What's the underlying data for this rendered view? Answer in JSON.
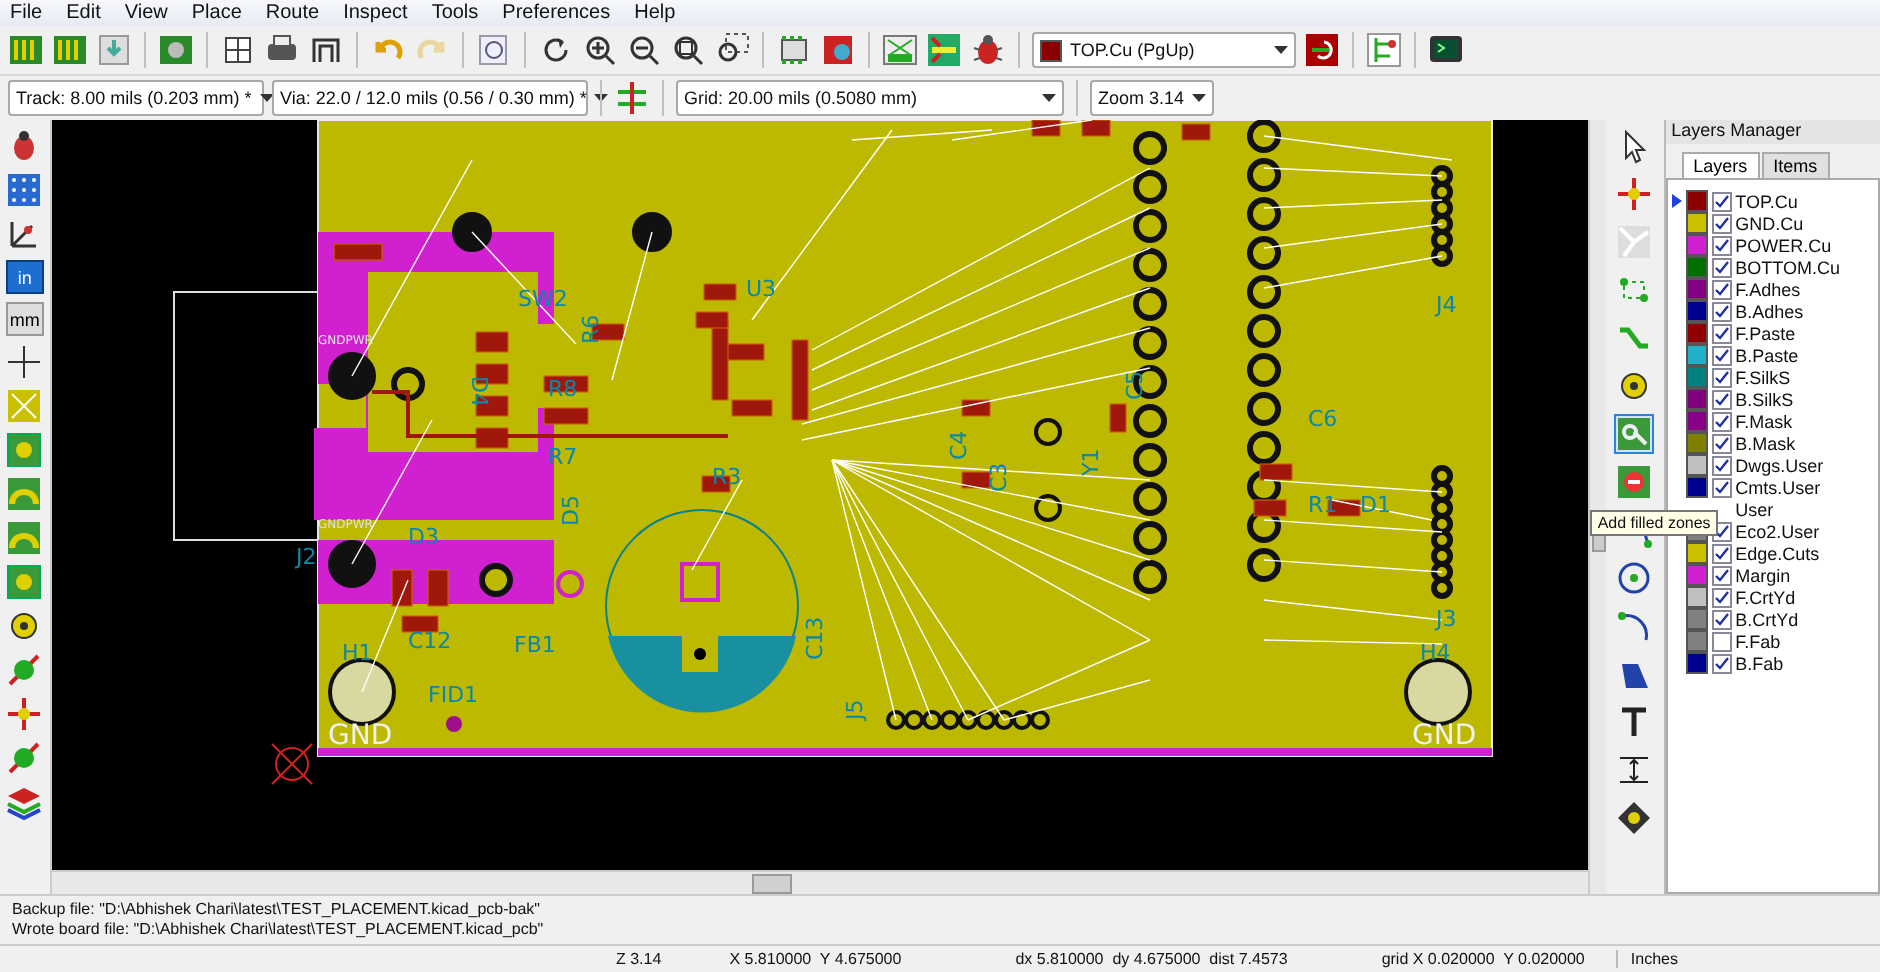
{
  "menu": [
    "File",
    "Edit",
    "View",
    "Place",
    "Route",
    "Inspect",
    "Tools",
    "Preferences",
    "Help"
  ],
  "toolbar": {
    "track": "Track: 8.00 mils (0.203 mm) *",
    "via": "Via: 22.0 / 12.0 mils (0.56 / 0.30 mm) *",
    "grid": "Grid: 20.00 mils (0.5080 mm)",
    "zoom": "Zoom 3.14",
    "layer": {
      "label": "TOP.Cu (PgUp)",
      "color": "#8b0000"
    }
  },
  "units": [
    {
      "label": "in",
      "selected": true
    },
    {
      "label": "mm",
      "selected": false
    }
  ],
  "pcb": {
    "labels": [
      {
        "text": "SW2",
        "kind": "ref"
      },
      {
        "text": "R6",
        "kind": "ref"
      },
      {
        "text": "U3",
        "kind": "ref"
      },
      {
        "text": "D4",
        "kind": "ref"
      },
      {
        "text": "R8",
        "kind": "ref"
      },
      {
        "text": "R7",
        "kind": "ref"
      },
      {
        "text": "D5",
        "kind": "ref"
      },
      {
        "text": "R3",
        "kind": "ref"
      },
      {
        "text": "C4",
        "kind": "ref"
      },
      {
        "text": "C3",
        "kind": "ref"
      },
      {
        "text": "Y1",
        "kind": "ref"
      },
      {
        "text": "C5",
        "kind": "ref"
      },
      {
        "text": "C6",
        "kind": "ref"
      },
      {
        "text": "R1",
        "kind": "ref"
      },
      {
        "text": "D1",
        "kind": "ref"
      },
      {
        "text": "J4",
        "kind": "ref"
      },
      {
        "text": "J3",
        "kind": "ref"
      },
      {
        "text": "J5",
        "kind": "ref"
      },
      {
        "text": "C13",
        "kind": "ref"
      },
      {
        "text": "FB1",
        "kind": "ref"
      },
      {
        "text": "D3",
        "kind": "ref"
      },
      {
        "text": "C12",
        "kind": "ref"
      },
      {
        "text": "H1",
        "kind": "ref"
      },
      {
        "text": "H4",
        "kind": "ref"
      },
      {
        "text": "FID1",
        "kind": "ref"
      },
      {
        "text": "J2",
        "kind": "ref"
      },
      {
        "text": "GND",
        "kind": "value"
      },
      {
        "text": "GND",
        "kind": "value"
      },
      {
        "text": "GNDPWR",
        "kind": "small"
      },
      {
        "text": "GNDPWR",
        "kind": "small"
      }
    ]
  },
  "layers_manager": {
    "title": "Layers Manager",
    "tabs": [
      {
        "label": "Layers",
        "selected": true
      },
      {
        "label": "Items",
        "selected": false
      }
    ],
    "layers": [
      {
        "name": "TOP.Cu",
        "color": "#8b0000",
        "visible": true,
        "selected": true
      },
      {
        "name": "GND.Cu",
        "color": "#c8c000",
        "visible": true,
        "selected": false
      },
      {
        "name": "POWER.Cu",
        "color": "#d020d0",
        "visible": true,
        "selected": false
      },
      {
        "name": "BOTTOM.Cu",
        "color": "#007000",
        "visible": true,
        "selected": false
      },
      {
        "name": "F.Adhes",
        "color": "#840084",
        "visible": true,
        "selected": false
      },
      {
        "name": "B.Adhes",
        "color": "#000090",
        "visible": true,
        "selected": false
      },
      {
        "name": "F.Paste",
        "color": "#900000",
        "visible": true,
        "selected": false
      },
      {
        "name": "B.Paste",
        "color": "#20b0c8",
        "visible": true,
        "selected": false
      },
      {
        "name": "F.SilkS",
        "color": "#008080",
        "visible": true,
        "selected": false
      },
      {
        "name": "B.SilkS",
        "color": "#800080",
        "visible": true,
        "selected": false
      },
      {
        "name": "F.Mask",
        "color": "#880088",
        "visible": true,
        "selected": false
      },
      {
        "name": "B.Mask",
        "color": "#808000",
        "visible": true,
        "selected": false
      },
      {
        "name": "Dwgs.User",
        "color": "#c0c0c0",
        "visible": true,
        "selected": false
      },
      {
        "name": "Cmts.User",
        "color": "#000090",
        "visible": true,
        "selected": false
      },
      {
        "name": "User",
        "selected": false
      },
      {
        "name": "Eco2.User",
        "color": "#808080",
        "visible": true,
        "selected": false
      },
      {
        "name": "Edge.Cuts",
        "color": "#c8c000",
        "visible": true,
        "selected": false
      },
      {
        "name": "Margin",
        "color": "#d020d0",
        "visible": true,
        "selected": false
      },
      {
        "name": "F.CrtYd",
        "color": "#c0c0c0",
        "visible": true,
        "selected": false
      },
      {
        "name": "B.CrtYd",
        "color": "#808080",
        "visible": true,
        "selected": false
      },
      {
        "name": "F.Fab",
        "color": "#808080",
        "visible": false,
        "selected": false
      },
      {
        "name": "B.Fab",
        "color": "#000090",
        "visible": true,
        "selected": false
      }
    ]
  },
  "tooltip": "Add filled zones",
  "messages": [
    "Backup file: \"D:\\Abhishek Chari\\latest\\TEST_PLACEMENT.kicad_pcb-bak\"",
    "Wrote board file: \"D:\\Abhishek Chari\\latest\\TEST_PLACEMENT.kicad_pcb\""
  ],
  "status_bar": {
    "zoom": "Z 3.14",
    "position": "X 5.810000  Y 4.675000",
    "delta": "dx 5.810000  dy 4.675000  dist 7.4573",
    "grid": "grid X 0.020000  Y 0.020000",
    "units": "Inches"
  }
}
